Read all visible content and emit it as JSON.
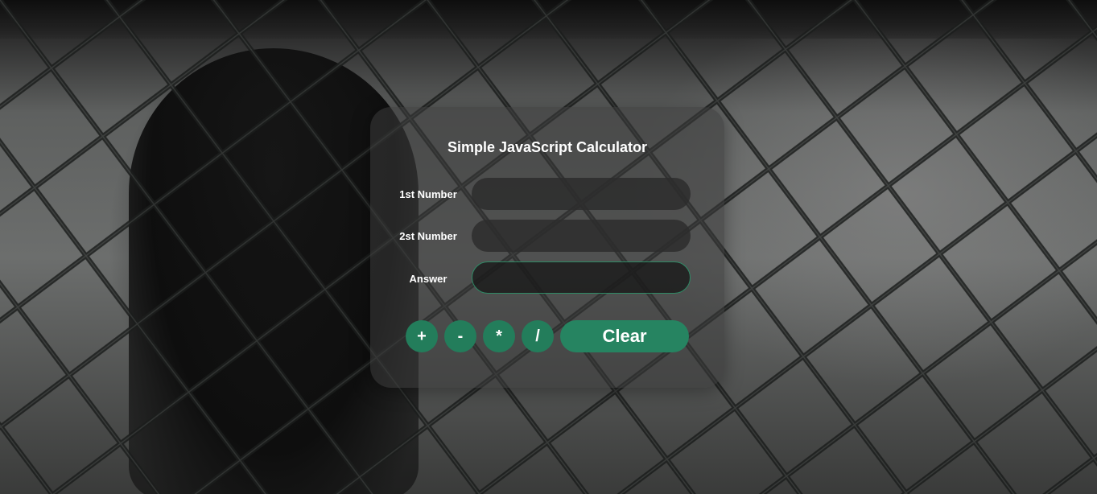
{
  "calculator": {
    "title": "Simple JavaScript Calculator",
    "first_number": {
      "label": "1st Number",
      "value": ""
    },
    "second_number": {
      "label": "2st Number",
      "value": ""
    },
    "answer": {
      "label": "Answer",
      "value": ""
    },
    "buttons": {
      "add": "+",
      "subtract": "-",
      "multiply": "*",
      "divide": "/",
      "clear": "Clear"
    }
  },
  "colors": {
    "accent": "#237d5b",
    "card": "#3a3a3a",
    "text": "#ffffff"
  }
}
